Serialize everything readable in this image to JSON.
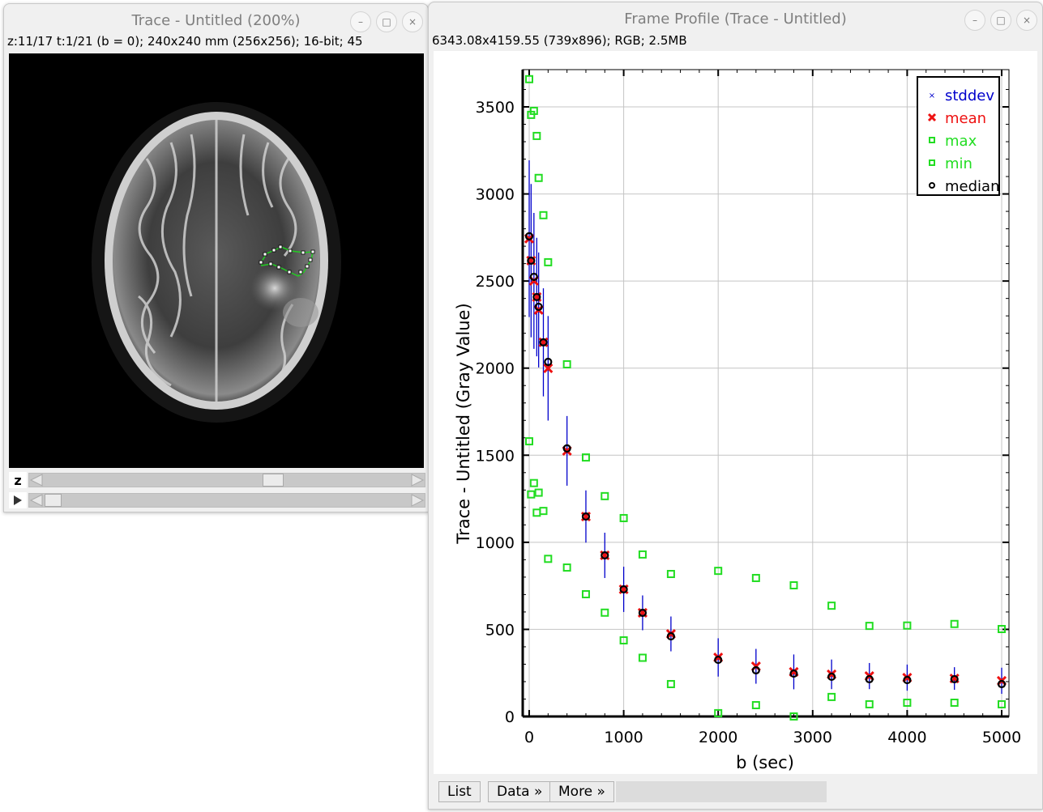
{
  "trace_window": {
    "title": "Trace - Untitled (200%)",
    "info": "z:11/17 t:1/21 (b = 0); 240x240 mm (256x256); 16-bit; 45",
    "z_slider_label": "z",
    "z_slider": {
      "current": 11,
      "total": 17
    },
    "t_slider": {
      "current": 1,
      "total": 21
    },
    "play_icon": "play-icon",
    "roi_color": "#22cc22"
  },
  "plot_window": {
    "title": "Frame Profile (Trace - Untitled)",
    "info": "6343.08x4159.55    (739x896); RGB; 2.5MB",
    "buttons": {
      "list": "List",
      "data": "Data »",
      "more": "More »"
    },
    "status_text": ""
  },
  "window_controls": {
    "minimize": "–",
    "maximize": "□",
    "close": "×"
  },
  "chart_data": {
    "type": "scatter",
    "title": "",
    "xlabel": "b (sec)",
    "ylabel": "Trace - Untitled (Gray Value)",
    "xlim": [
      0,
      5000
    ],
    "ylim": [
      0,
      3700
    ],
    "xticks": [
      0,
      1000,
      2000,
      3000,
      4000,
      5000
    ],
    "yticks": [
      0,
      500,
      1000,
      1500,
      2000,
      2500,
      3000,
      3500
    ],
    "grid": true,
    "legend_position": "top-right",
    "x": [
      0,
      20,
      50,
      80,
      100,
      150,
      200,
      400,
      600,
      800,
      1000,
      1200,
      1500,
      2000,
      2400,
      2800,
      3200,
      3600,
      4000,
      4500,
      5000
    ],
    "series": [
      {
        "name": "stddev",
        "color": "#0000cc",
        "marker": "error-bar",
        "values": [
          450,
          440,
          390,
          340,
          330,
          310,
          300,
          200,
          150,
          130,
          130,
          100,
          100,
          110,
          100,
          100,
          85,
          75,
          75,
          65,
          75
        ]
      },
      {
        "name": "mean",
        "color": "#ee1111",
        "marker": "x",
        "values": [
          2743,
          2617,
          2501,
          2408,
          2334,
          2148,
          1999,
          1525,
          1148,
          925,
          730,
          595,
          474,
          339,
          288,
          256,
          242,
          232,
          223,
          218,
          205
        ]
      },
      {
        "name": "max",
        "color": "#22dd22",
        "marker": "square",
        "values": [
          3659,
          3454,
          3477,
          3333,
          3092,
          2878,
          2608,
          2022,
          1487,
          1265,
          1139,
          930,
          818,
          836,
          795,
          753,
          636,
          520,
          522,
          531,
          502
        ]
      },
      {
        "name": "min",
        "color": "#22dd22",
        "marker": "square",
        "values": [
          1580,
          1275,
          1340,
          1170,
          1285,
          1180,
          905,
          855,
          702,
          596,
          437,
          337,
          186,
          19,
          65,
          0,
          112,
          70,
          79,
          79,
          70
        ]
      },
      {
        "name": "median",
        "color": "#000000",
        "marker": "circle",
        "values": [
          2757,
          2617,
          2524,
          2408,
          2352,
          2148,
          2036,
          1539,
          1148,
          925,
          730,
          595,
          460,
          325,
          265,
          246,
          228,
          214,
          209,
          214,
          186
        ]
      }
    ]
  }
}
